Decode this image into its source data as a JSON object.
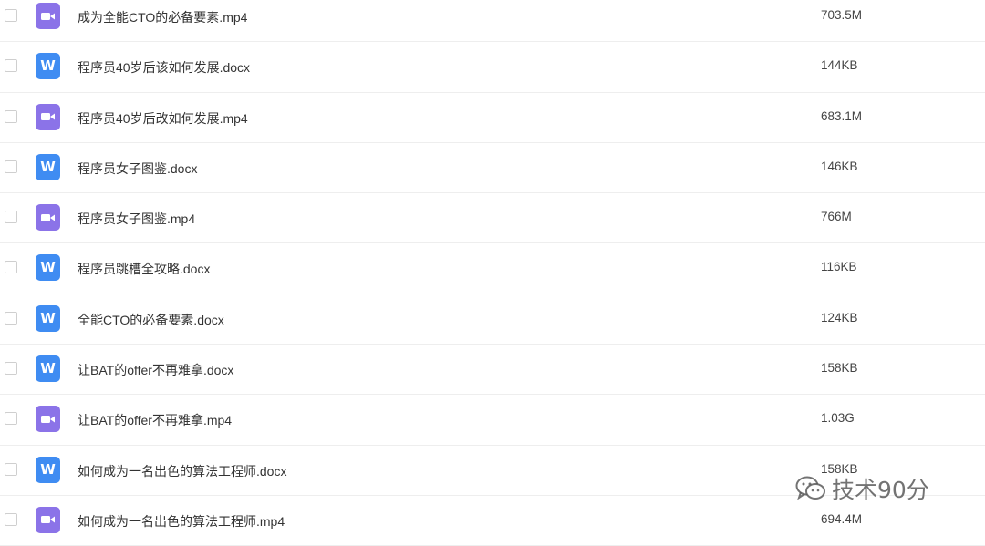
{
  "files": [
    {
      "name": "成为全能CTO的必备要素.mp4",
      "size": "703.5M",
      "type": "video",
      "icon": "video-file-icon"
    },
    {
      "name": "程序员40岁后该如何发展.docx",
      "size": "144KB",
      "type": "word",
      "icon": "word-file-icon",
      "icon_letter": "W"
    },
    {
      "name": "程序员40岁后改如何发展.mp4",
      "size": "683.1M",
      "type": "video",
      "icon": "video-file-icon"
    },
    {
      "name": "程序员女子图鉴.docx",
      "size": "146KB",
      "type": "word",
      "icon": "word-file-icon",
      "icon_letter": "W"
    },
    {
      "name": "程序员女子图鉴.mp4",
      "size": "766M",
      "type": "video",
      "icon": "video-file-icon"
    },
    {
      "name": "程序员跳槽全攻略.docx",
      "size": "116KB",
      "type": "word",
      "icon": "word-file-icon",
      "icon_letter": "W"
    },
    {
      "name": "全能CTO的必备要素.docx",
      "size": "124KB",
      "type": "word",
      "icon": "word-file-icon",
      "icon_letter": "W"
    },
    {
      "name": "让BAT的offer不再难拿.docx",
      "size": "158KB",
      "type": "word",
      "icon": "word-file-icon",
      "icon_letter": "W"
    },
    {
      "name": "让BAT的offer不再难拿.mp4",
      "size": "1.03G",
      "type": "video",
      "icon": "video-file-icon"
    },
    {
      "name": "如何成为一名出色的算法工程师.docx",
      "size": "158KB",
      "type": "word",
      "icon": "word-file-icon",
      "icon_letter": "W"
    },
    {
      "name": "如何成为一名出色的算法工程师.mp4",
      "size": "694.4M",
      "type": "video",
      "icon": "video-file-icon"
    }
  ],
  "watermark": {
    "text": "技术90分",
    "icon": "wechat-icon"
  },
  "colors": {
    "video_icon": "#8b73e8",
    "word_icon": "#3f8cf2",
    "divider": "#eeeeee",
    "text": "#333333"
  }
}
